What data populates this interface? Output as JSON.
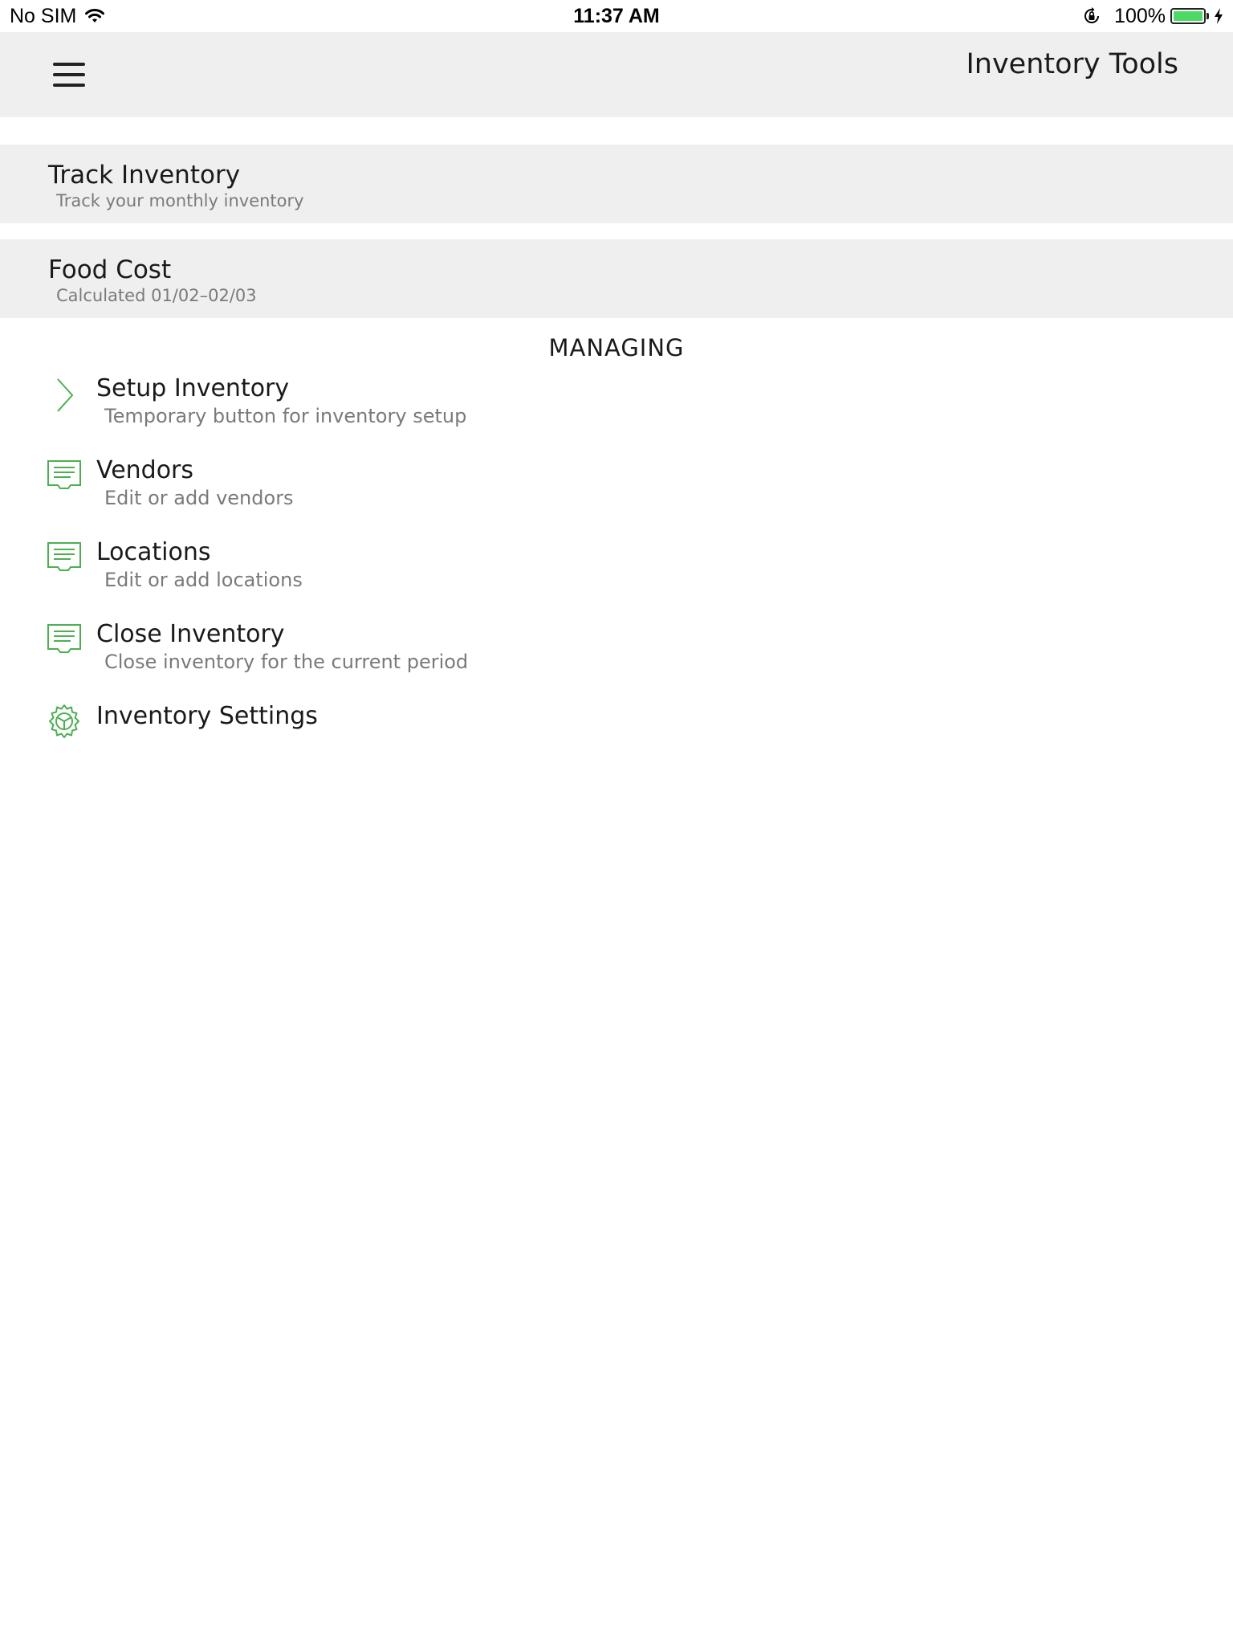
{
  "status_bar": {
    "carrier": "No SIM",
    "time": "11:37 AM",
    "battery_percent": "100%",
    "battery_level": 1.0,
    "wifi_icon": "wifi-icon",
    "orientation_lock_icon": "orientation-lock-icon",
    "charging_icon": "charging-bolt-icon"
  },
  "header": {
    "menu_icon": "hamburger-menu-icon",
    "title": "Inventory Tools"
  },
  "cards": [
    {
      "title": "Track Inventory",
      "subtitle": "Track your monthly inventory"
    },
    {
      "title": "Food Cost",
      "subtitle": "Calculated 01/02–02/03"
    }
  ],
  "managing": {
    "section_title": "MANAGING",
    "items": [
      {
        "title": "Setup Inventory",
        "subtitle": "Temporary button for inventory setup",
        "icon": "chevron-right-icon"
      },
      {
        "title": "Vendors",
        "subtitle": "Edit or add vendors",
        "icon": "list-card-icon"
      },
      {
        "title": "Locations",
        "subtitle": "Edit or add locations",
        "icon": "list-card-icon"
      },
      {
        "title": "Close Inventory",
        "subtitle": "Close inventory for the current period",
        "icon": "list-card-icon"
      },
      {
        "title": "Inventory Settings",
        "subtitle": "",
        "icon": "gear-icon"
      }
    ]
  },
  "colors": {
    "accent": "#4caf50",
    "header_bg": "#efefef",
    "card_bg": "#efefef",
    "subtitle_text": "#7a7a7a",
    "battery": "#4cd964"
  }
}
